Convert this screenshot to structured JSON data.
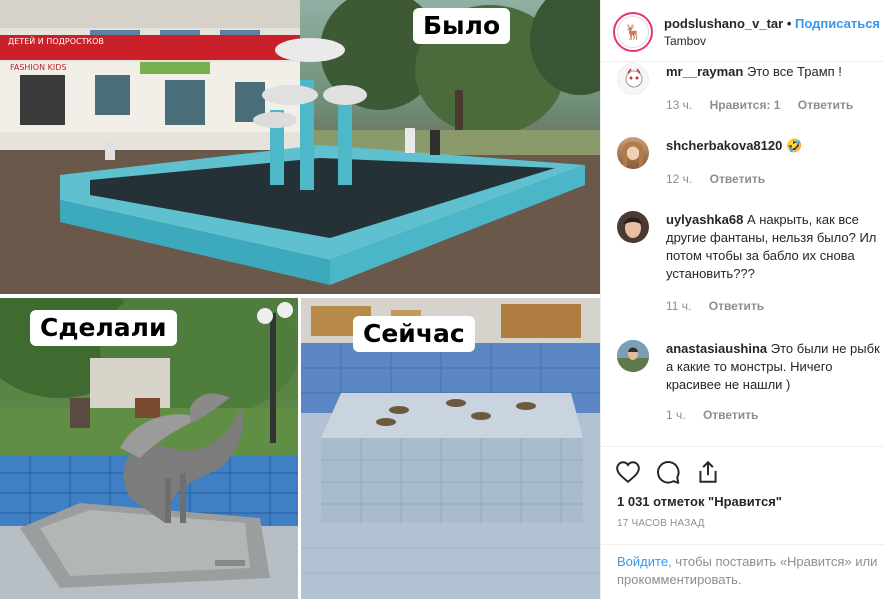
{
  "photo": {
    "captions": {
      "before": "Было",
      "made": "Сделали",
      "now": "Сейчас"
    },
    "signs": {
      "store": "ДЕТЕЙ И ПОДРОСТКОВ",
      "fashion": "FASHION KIDS"
    }
  },
  "header": {
    "username": "podslushano_v_tar",
    "separator": "•",
    "follow_label": "Подписаться",
    "location": "Tambov"
  },
  "comments": [
    {
      "username": "mr__rayman",
      "text": "Это все Трамп !",
      "time": "13 ч.",
      "likes": "Нравится: 1",
      "reply": "Ответить"
    },
    {
      "username": "shcherbakova8120",
      "text": "🤣",
      "time": "12 ч.",
      "reply": "Ответить"
    },
    {
      "username": "uylyashka68",
      "text": "А накрыть, как все другие фантаны, нельзя было? Ил\nпотом чтобы за бабло их снова\nустановить???",
      "time": "11 ч.",
      "reply": "Ответить"
    },
    {
      "username": "anastasiaushina",
      "text": "Это были не рыбк\nа какие то монстры. Ничего\nкрасивее не нашли )",
      "time": "1 ч.",
      "reply": "Ответить"
    }
  ],
  "post": {
    "likes": "1 031 отметок \"Нравится\"",
    "timestamp": "17 ЧАСОВ НАЗАД",
    "login_link": "Войдите",
    "login_text": ", чтобы поставить «Нравится» или",
    "login_text2": "прокомментировать."
  },
  "colors": {
    "accent": "#3897f0",
    "text": "#262626",
    "muted": "#8e8e8e",
    "fountain": "#4cb8c8"
  },
  "icons": [
    "heart-icon",
    "comment-icon",
    "share-icon"
  ]
}
